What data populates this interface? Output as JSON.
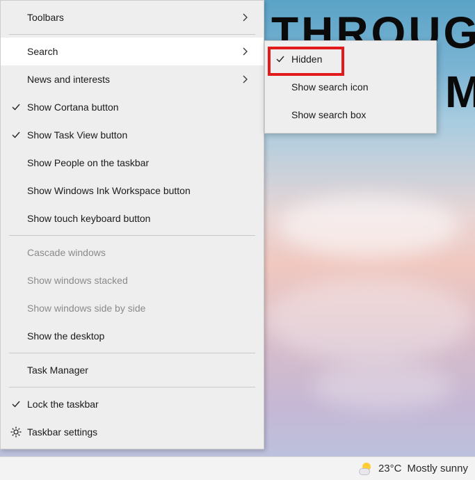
{
  "bg": {
    "line1": "THROUGH",
    "line2": "M"
  },
  "menu": {
    "items": [
      {
        "label": "Toolbars",
        "icon": "",
        "arrow": true,
        "disabled": false
      },
      {
        "label": "Search",
        "icon": "",
        "arrow": true,
        "disabled": false,
        "highlight": true
      },
      {
        "label": "News and interests",
        "icon": "",
        "arrow": true,
        "disabled": false
      },
      {
        "label": "Show Cortana button",
        "icon": "check",
        "arrow": false,
        "disabled": false
      },
      {
        "label": "Show Task View button",
        "icon": "check",
        "arrow": false,
        "disabled": false
      },
      {
        "label": "Show People on the taskbar",
        "icon": "",
        "arrow": false,
        "disabled": false
      },
      {
        "label": "Show Windows Ink Workspace button",
        "icon": "",
        "arrow": false,
        "disabled": false
      },
      {
        "label": "Show touch keyboard button",
        "icon": "",
        "arrow": false,
        "disabled": false
      },
      {
        "label": "Cascade windows",
        "icon": "",
        "arrow": false,
        "disabled": true
      },
      {
        "label": "Show windows stacked",
        "icon": "",
        "arrow": false,
        "disabled": true
      },
      {
        "label": "Show windows side by side",
        "icon": "",
        "arrow": false,
        "disabled": true
      },
      {
        "label": "Show the desktop",
        "icon": "",
        "arrow": false,
        "disabled": false
      },
      {
        "label": "Task Manager",
        "icon": "",
        "arrow": false,
        "disabled": false
      },
      {
        "label": "Lock the taskbar",
        "icon": "check",
        "arrow": false,
        "disabled": false
      },
      {
        "label": "Taskbar settings",
        "icon": "gear",
        "arrow": false,
        "disabled": false
      }
    ],
    "separators_after": [
      0,
      7,
      11,
      12
    ]
  },
  "submenu": {
    "items": [
      {
        "label": "Hidden",
        "icon": "check"
      },
      {
        "label": "Show search icon",
        "icon": ""
      },
      {
        "label": "Show search box",
        "icon": ""
      }
    ]
  },
  "taskbar": {
    "temp": "23°C",
    "condition": "Mostly sunny"
  }
}
